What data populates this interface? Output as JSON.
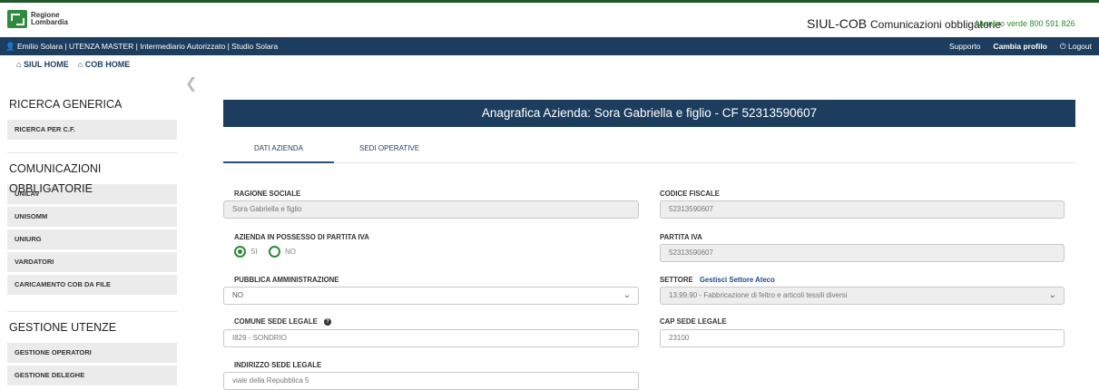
{
  "logo": {
    "line1": "Regione",
    "line2": "Lombardia"
  },
  "app": {
    "title": "SIUL-COB",
    "subtitle": "Comunicazioni obbligatorie",
    "verde": "Numero verde 800 591 826"
  },
  "userbar": {
    "user": "Emilio Solara | UTENZA MASTER | Intermediario Autorizzato | Studio Solara",
    "supporto": "Supporto",
    "cambia": "Cambia profilo",
    "logout": "Logout"
  },
  "nav": {
    "siul_home": "SIUL HOME",
    "cob_home": "COB HOME"
  },
  "sidebar": {
    "ricerca_title": "RICERCA GENERICA",
    "ricerca_items": [
      "RICERCA PER C.F."
    ],
    "comunicazioni_title": "COMUNICAZIONI OBBLIGATORIE",
    "comunicazioni_items": [
      "UNILAV",
      "UNISOMM",
      "UNIURG",
      "VARDATORI",
      "CARICAMENTO COB DA FILE"
    ],
    "gestione_title": "GESTIONE UTENZE",
    "gestione_items": [
      "GESTIONE OPERATORI",
      "GESTIONE DELEGHE"
    ]
  },
  "main": {
    "header": "Anagrafica Azienda: Sora Gabriella e figlio - CF 52313590607",
    "tabs": [
      "DATI AZIENDA",
      "SEDI OPERATIVE"
    ]
  },
  "form": {
    "ragione_sociale_label": "RAGIONE SOCIALE",
    "ragione_sociale_value": "Sora Gabriella e figlio",
    "codice_fiscale_label": "CODICE FISCALE",
    "codice_fiscale_value": "52313590607",
    "possesso_iva_label": "AZIENDA IN POSSESSO DI PARTITA IVA",
    "radio_si": "SI",
    "radio_no": "NO",
    "partita_iva_label": "PARTITA IVA",
    "partita_iva_value": "52313590607",
    "pubblica_amm_label": "PUBBLICA AMMINISTRAZIONE",
    "pubblica_amm_value": "NO",
    "settore_label": "SETTORE",
    "settore_link": "Gestisci Settore Ateco",
    "settore_value": "13.99.90 - Fabbricazione di feltro e articoli tessili diversi",
    "comune_label": "COMUNE SEDE LEGALE",
    "comune_value": "I829 - SONDRIO",
    "cap_label": "CAP SEDE LEGALE",
    "cap_value": "23100",
    "indirizzo_label": "INDIRIZZO SEDE LEGALE",
    "indirizzo_value": "viale della Repubblica 5"
  }
}
